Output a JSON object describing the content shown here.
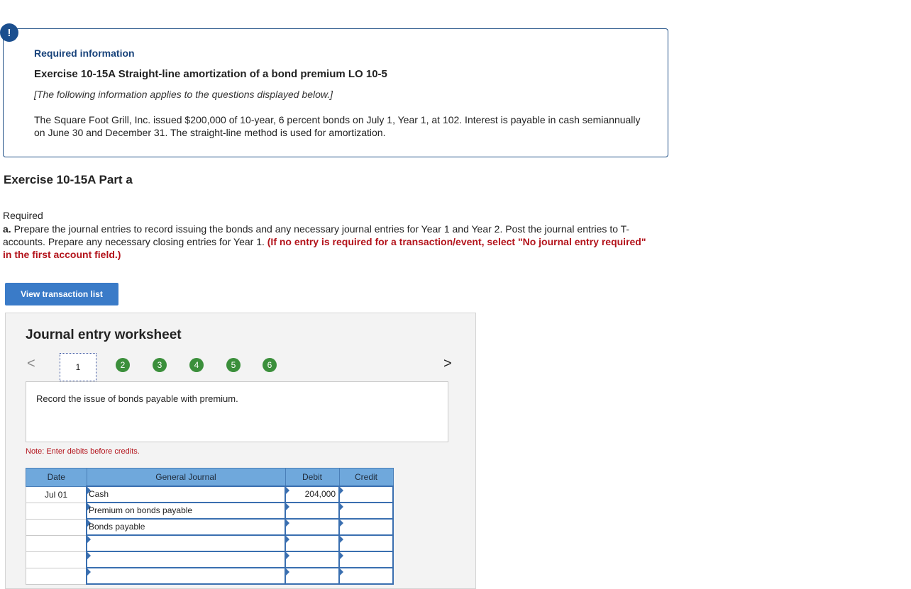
{
  "alert": {
    "symbol": "!"
  },
  "info": {
    "required_title": "Required information",
    "exercise_title": "Exercise 10-15A Straight-line amortization of a bond premium LO 10-5",
    "applies_note": "[The following information applies to the questions displayed below.]",
    "description": "The Square Foot Grill, Inc. issued $200,000 of 10-year, 6 percent bonds on July 1, Year 1, at 102. Interest is payable in cash semiannually on June 30 and December 31. The straight-line method is used for amortization."
  },
  "part": {
    "title": "Exercise 10-15A Part a"
  },
  "required": {
    "heading": "Required",
    "letter": "a.",
    "text": " Prepare the journal entries to record issuing the bonds and any necessary journal entries for Year 1 and Year 2. Post the journal entries to T-accounts. Prepare any necessary closing entries for Year 1. ",
    "red_text": "(If no entry is required for a transaction/event, select \"No journal entry required\" in the first account field.)"
  },
  "view_button": {
    "label": "View transaction list"
  },
  "worksheet": {
    "title": "Journal entry worksheet",
    "prev_symbol": "<",
    "next_symbol": ">",
    "current_step": "1",
    "steps": [
      "2",
      "3",
      "4",
      "5",
      "6"
    ],
    "instruction": "Record the issue of bonds payable with premium.",
    "note": "Note: Enter debits before credits.",
    "columns": {
      "date": "Date",
      "journal": "General Journal",
      "debit": "Debit",
      "credit": "Credit"
    },
    "rows": [
      {
        "date": "Jul 01",
        "account": "Cash",
        "debit": "204,000",
        "credit": ""
      },
      {
        "date": "",
        "account": "Premium on bonds payable",
        "debit": "",
        "credit": ""
      },
      {
        "date": "",
        "account": "Bonds payable",
        "debit": "",
        "credit": ""
      },
      {
        "date": "",
        "account": "",
        "debit": "",
        "credit": ""
      },
      {
        "date": "",
        "account": "",
        "debit": "",
        "credit": ""
      },
      {
        "date": "",
        "account": "",
        "debit": "",
        "credit": ""
      }
    ]
  }
}
